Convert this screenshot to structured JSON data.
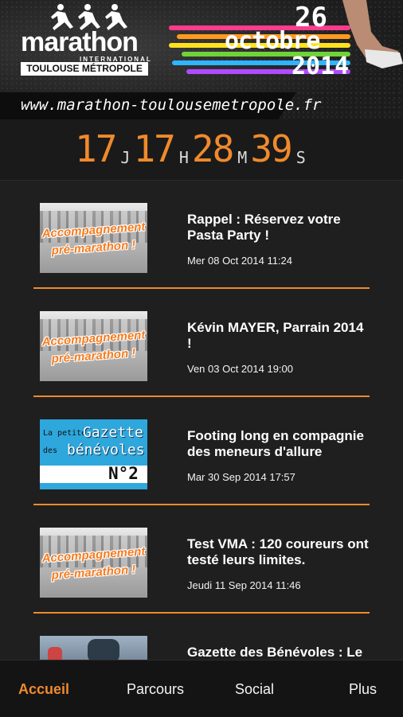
{
  "header": {
    "logo_word": "marathon",
    "logo_sub": "INTERNATIONAL",
    "logo_city": "TOULOUSE MÉTROPOLE",
    "event_day": "26",
    "event_month": "octobre",
    "event_year": "2014",
    "url": "www.marathon-toulousemetropole.fr",
    "stripe_colors": [
      "#ff3b8d",
      "#ff9a1f",
      "#ffe21f",
      "#6fd33a",
      "#2fb4ff",
      "#b04bff"
    ]
  },
  "countdown": {
    "days": "17",
    "days_unit": "J",
    "hours": "17",
    "hours_unit": "H",
    "minutes": "28",
    "minutes_unit": "M",
    "seconds": "39",
    "seconds_unit": "S",
    "accent": "#f08a2c"
  },
  "thumbnails": {
    "accomp_line1": "Accompagnement",
    "accomp_line2": "pré-marathon !",
    "gazette_la": "La petite",
    "gazette_title": "Gazette",
    "gazette_des": "des",
    "gazette_sub": "bénévoles",
    "gazette_num": "N°2"
  },
  "news": [
    {
      "title": "Rappel : Réservez votre Pasta Party !",
      "date": "Mer 08 Oct 2014 11:24",
      "thumb": "accomp"
    },
    {
      "title": "Kévin MAYER, Parrain 2014 !",
      "date": "Ven 03 Oct 2014 19:00",
      "thumb": "accomp"
    },
    {
      "title": "Footing long en compagnie des meneurs d'allure",
      "date": "Mar 30 Sep 2014 17:57",
      "thumb": "gazette"
    },
    {
      "title": "Test VMA : 120 coureurs ont testé leurs limites.",
      "date": "Jeudi 11 Sep 2014 11:46",
      "thumb": "accomp"
    },
    {
      "title": "Gazette des Bénévoles : Le",
      "date": "",
      "thumb": "race"
    }
  ],
  "nav": {
    "items": [
      {
        "label": "Accueil",
        "active": true
      },
      {
        "label": "Parcours",
        "active": false
      },
      {
        "label": "Social",
        "active": false
      },
      {
        "label": "Plus",
        "active": false
      }
    ]
  }
}
